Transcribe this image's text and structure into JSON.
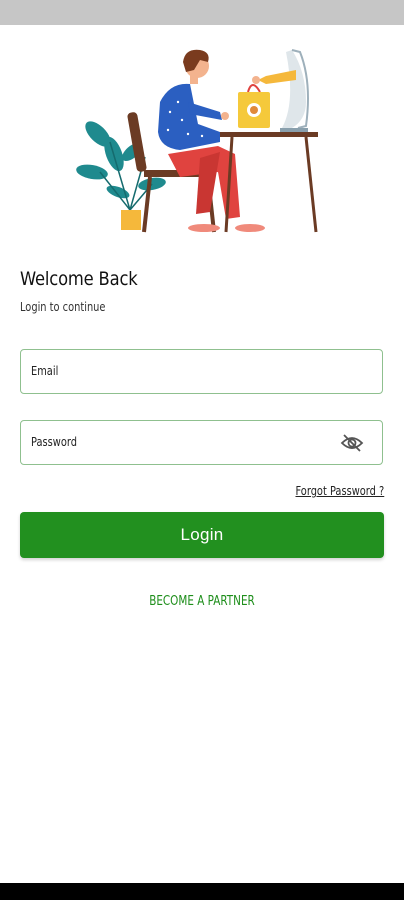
{
  "login": {
    "title": "Welcome Back",
    "subtitle": "Login to continue",
    "email_label": "Email",
    "password_label": "Password",
    "forgot_password": "Forgot Password ?",
    "login_button": "Login",
    "partner_link": "BECOME A PARTNER"
  },
  "colors": {
    "primary_green": "#22901f",
    "field_border": "#8fc08f",
    "link_green": "#1e8e1b"
  },
  "icons": {
    "password_toggle": "eye-off-icon"
  }
}
